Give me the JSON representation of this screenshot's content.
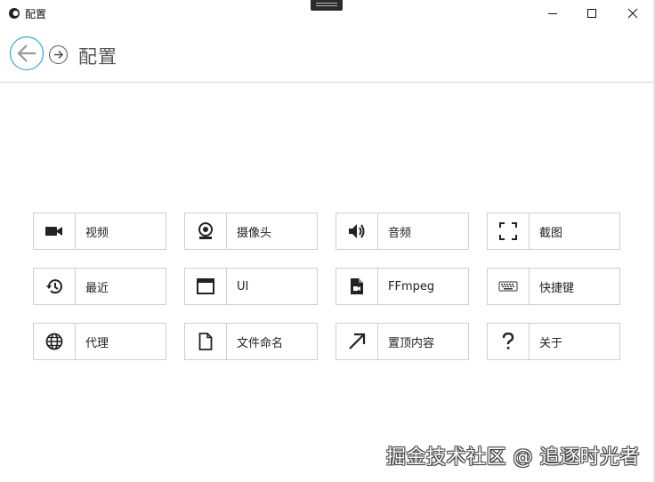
{
  "window": {
    "title": "配置",
    "controls": {
      "minimize": "minimize",
      "maximize": "maximize",
      "close": "close"
    }
  },
  "header": {
    "title": "配置",
    "accent_color": "#1e90d6"
  },
  "tiles": [
    {
      "label": "视频",
      "icon": "video-camera-icon"
    },
    {
      "label": "摄像头",
      "icon": "webcam-icon"
    },
    {
      "label": "音频",
      "icon": "speaker-icon"
    },
    {
      "label": "截图",
      "icon": "screenshot-frame-icon"
    },
    {
      "label": "最近",
      "icon": "history-icon"
    },
    {
      "label": "UI",
      "icon": "window-icon"
    },
    {
      "label": "FFmpeg",
      "icon": "video-file-icon"
    },
    {
      "label": "快捷键",
      "icon": "keyboard-icon"
    },
    {
      "label": "代理",
      "icon": "globe-icon"
    },
    {
      "label": "文件命名",
      "icon": "file-icon"
    },
    {
      "label": "置顶内容",
      "icon": "arrow-up-right-icon"
    },
    {
      "label": "关于",
      "icon": "question-mark-icon"
    }
  ],
  "watermark": "掘金技术社区 @ 追逐时光者"
}
